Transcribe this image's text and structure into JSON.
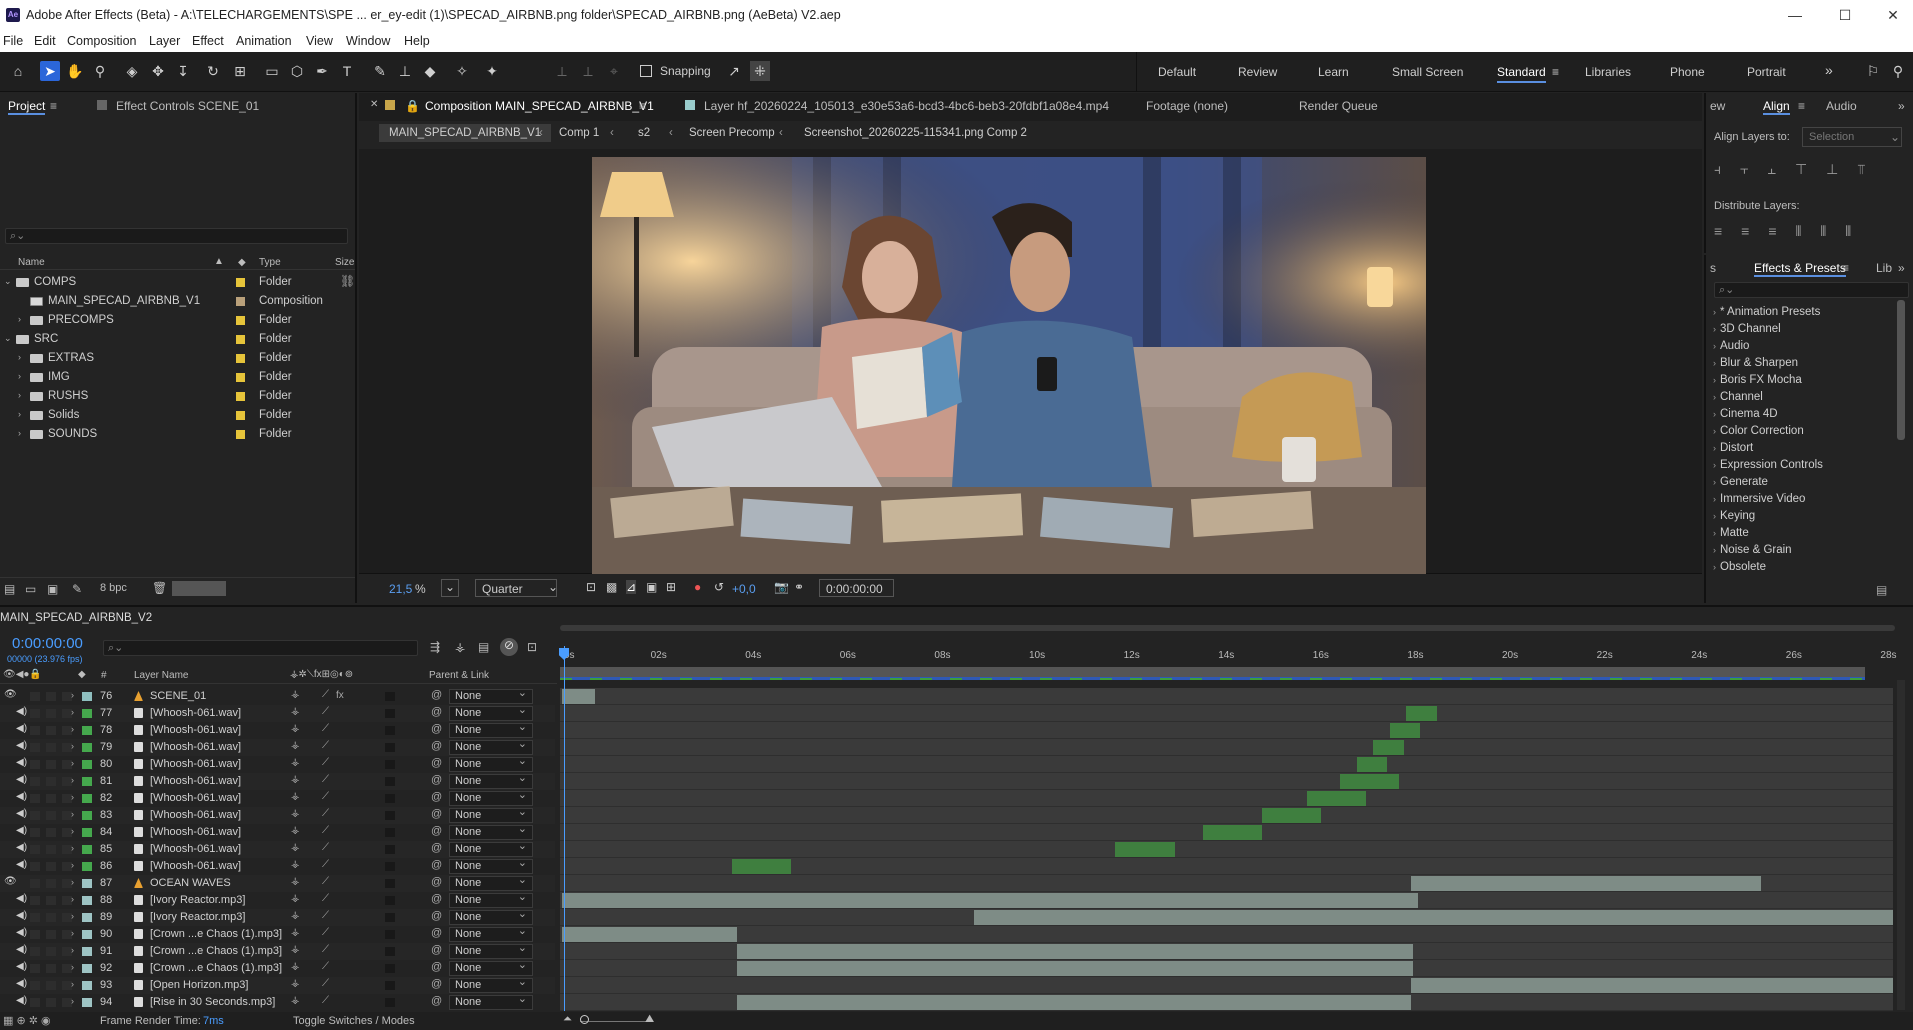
{
  "titlebar": {
    "title": "Adobe After Effects (Beta) - A:\\TELECHARGEMENTS\\SPE ... er_ey-edit (1)\\SPECAD_AIRBNB.png folder\\SPECAD_AIRBNB.png (AeBeta) V2.aep",
    "logo": "Ae",
    "min": "—",
    "max": "☐",
    "close": "✕"
  },
  "menu": [
    "File",
    "Edit",
    "Composition",
    "Layer",
    "Effect",
    "Animation",
    "View",
    "Window",
    "Help"
  ],
  "toolbar": {
    "snapping": "Snapping",
    "workspaces": [
      "Default",
      "Review",
      "Learn",
      "Small Screen",
      "Standard",
      "Libraries",
      "Phone",
      "Portrait"
    ],
    "active_workspace": "Standard",
    "more": "»"
  },
  "project": {
    "tab": "Project",
    "tab2": "Effect Controls SCENE_01",
    "search_placeholder": "⌕⌄",
    "columns": {
      "name": "Name",
      "type": "Type",
      "size": "Size"
    },
    "items": [
      {
        "name": "COMPS",
        "type": "Folder",
        "expanded": true,
        "indent": 0,
        "kind": "folder",
        "color": "#e6c43a"
      },
      {
        "name": "MAIN_SPECAD_AIRBNB_V1",
        "type": "Composition",
        "indent": 1,
        "kind": "comp",
        "color": "#b9a07a"
      },
      {
        "name": "PRECOMPS",
        "type": "Folder",
        "indent": 1,
        "kind": "folder",
        "color": "#e6c43a"
      },
      {
        "name": "SRC",
        "type": "Folder",
        "expanded": true,
        "indent": 0,
        "kind": "folder",
        "color": "#e6c43a"
      },
      {
        "name": "EXTRAS",
        "type": "Folder",
        "indent": 1,
        "kind": "folder",
        "color": "#e6c43a"
      },
      {
        "name": "IMG",
        "type": "Folder",
        "indent": 1,
        "kind": "folder",
        "color": "#e6c43a"
      },
      {
        "name": "RUSHS",
        "type": "Folder",
        "indent": 1,
        "kind": "folder",
        "color": "#e6c43a"
      },
      {
        "name": "Solids",
        "type": "Folder",
        "indent": 1,
        "kind": "folder",
        "color": "#e6c43a"
      },
      {
        "name": "SOUNDS",
        "type": "Folder",
        "indent": 1,
        "kind": "folder",
        "color": "#e6c43a"
      }
    ],
    "bpc": "8 bpc"
  },
  "comp": {
    "tab": "Composition MAIN_SPECAD_AIRBNB_V1",
    "layer_tab": "Layer hf_20260224_105013_e30e53a6-bcd3-4bc6-beb3-20fdbf1a08e4.mp4",
    "footage_tab": "Footage (none)",
    "render_tab": "Render Queue",
    "breadcrumbs": [
      "MAIN_SPECAD_AIRBNB_V1",
      "Comp 1",
      "s2",
      "Screen Precomp",
      "Screenshot_20260225-115341.png Comp 2"
    ],
    "zoom": "21,5",
    "zoom_unit": "%",
    "resolution": "Quarter",
    "exposure": "+0,0",
    "timecode": "0:00:00:00"
  },
  "align": {
    "tab0": "ew",
    "tab": "Align",
    "tab2": "Audio",
    "align_to_label": "Align Layers to:",
    "align_to_value": "Selection",
    "distribute_label": "Distribute Layers:"
  },
  "effects": {
    "tab0": "s",
    "tab": "Effects & Presets",
    "tab2": "Lib",
    "items": [
      "* Animation Presets",
      "3D Channel",
      "Audio",
      "Blur & Sharpen",
      "Boris FX Mocha",
      "Channel",
      "Cinema 4D",
      "Color Correction",
      "Distort",
      "Expression Controls",
      "Generate",
      "Immersive Video",
      "Keying",
      "Matte",
      "Noise & Grain",
      "Obsolete"
    ]
  },
  "timeline": {
    "comp_name": "MAIN_SPECAD_AIRBNB_V2",
    "timecode": "0:00:00:00",
    "fps": "00000 (23.976 fps)",
    "col_num": "#",
    "col_layer": "Layer Name",
    "col_parent": "Parent & Link",
    "ticks": [
      "0s",
      "02s",
      "04s",
      "06s",
      "08s",
      "10s",
      "12s",
      "14s",
      "16s",
      "18s",
      "20s",
      "22s",
      "24s",
      "26s",
      "28s"
    ],
    "layers": [
      {
        "num": "76",
        "name": "SCENE_01",
        "color": "#8fbfbf",
        "kind": "shape",
        "fx": "fx",
        "parent": "None",
        "bar_start": 0,
        "bar_end": 0.69
      },
      {
        "num": "77",
        "name": "[Whoosh-061.wav]",
        "color": "#45a84d",
        "kind": "audio",
        "parent": "None",
        "bar_start": 17.85,
        "bar_end": 18.5,
        "green": true
      },
      {
        "num": "78",
        "name": "[Whoosh-061.wav]",
        "color": "#45a84d",
        "kind": "audio",
        "parent": "None",
        "bar_start": 17.5,
        "bar_end": 18.15,
        "green": true
      },
      {
        "num": "79",
        "name": "[Whoosh-061.wav]",
        "color": "#45a84d",
        "kind": "audio",
        "parent": "None",
        "bar_start": 17.15,
        "bar_end": 17.8,
        "green": true
      },
      {
        "num": "80",
        "name": "[Whoosh-061.wav]",
        "color": "#45a84d",
        "kind": "audio",
        "parent": "None",
        "bar_start": 16.8,
        "bar_end": 17.45,
        "green": true
      },
      {
        "num": "81",
        "name": "[Whoosh-061.wav]",
        "color": "#45a84d",
        "kind": "audio",
        "parent": "None",
        "bar_start": 16.45,
        "bar_end": 17.7,
        "green": true
      },
      {
        "num": "82",
        "name": "[Whoosh-061.wav]",
        "color": "#45a84d",
        "kind": "audio",
        "parent": "None",
        "bar_start": 15.75,
        "bar_end": 17.0,
        "green": true
      },
      {
        "num": "83",
        "name": "[Whoosh-061.wav]",
        "color": "#45a84d",
        "kind": "audio",
        "parent": "None",
        "bar_start": 14.8,
        "bar_end": 16.05,
        "green": true
      },
      {
        "num": "84",
        "name": "[Whoosh-061.wav]",
        "color": "#45a84d",
        "kind": "audio",
        "parent": "None",
        "bar_start": 13.55,
        "bar_end": 14.8,
        "green": true
      },
      {
        "num": "85",
        "name": "[Whoosh-061.wav]",
        "color": "#45a84d",
        "kind": "audio",
        "parent": "None",
        "bar_start": 11.7,
        "bar_end": 12.95,
        "green": true
      },
      {
        "num": "86",
        "name": "[Whoosh-061.wav]",
        "color": "#45a84d",
        "kind": "audio",
        "parent": "None",
        "bar_start": 3.6,
        "bar_end": 4.85,
        "green": true
      },
      {
        "num": "87",
        "name": "OCEAN WAVES",
        "color": "#9ec4c4",
        "kind": "shape",
        "parent": "None",
        "bar_start": 17.95,
        "bar_end": 25.35
      },
      {
        "num": "88",
        "name": "[Ivory Reactor.mp3]",
        "color": "#9ec4c4",
        "kind": "audio",
        "parent": "None",
        "bar_start": 0,
        "bar_end": 18.1
      },
      {
        "num": "89",
        "name": "[Ivory Reactor.mp3]",
        "color": "#9ec4c4",
        "kind": "audio",
        "parent": "None",
        "bar_start": 8.7,
        "bar_end": 28.5
      },
      {
        "num": "90",
        "name": "[Crown ...e Chaos (1).mp3]",
        "color": "#9ec4c4",
        "kind": "audio",
        "parent": "None",
        "bar_start": 0,
        "bar_end": 3.7
      },
      {
        "num": "91",
        "name": "[Crown ...e Chaos (1).mp3]",
        "color": "#9ec4c4",
        "kind": "audio",
        "parent": "None",
        "bar_start": 3.7,
        "bar_end": 18.0
      },
      {
        "num": "92",
        "name": "[Crown ...e Chaos (1).mp3]",
        "color": "#9ec4c4",
        "kind": "audio",
        "parent": "None",
        "bar_start": 3.7,
        "bar_end": 18.0
      },
      {
        "num": "93",
        "name": "[Open Horizon.mp3]",
        "color": "#9ec4c4",
        "kind": "audio",
        "parent": "None",
        "bar_start": 17.95,
        "bar_end": 28.5
      },
      {
        "num": "94",
        "name": "[Rise in 30 Seconds.mp3]",
        "color": "#9ec4c4",
        "kind": "audio",
        "parent": "None",
        "bar_start": 3.7,
        "bar_end": 17.95
      }
    ],
    "frame_render_label": "Frame Render Time:",
    "frame_render_value": "7ms",
    "toggle_label": "Toggle Switches / Modes"
  }
}
